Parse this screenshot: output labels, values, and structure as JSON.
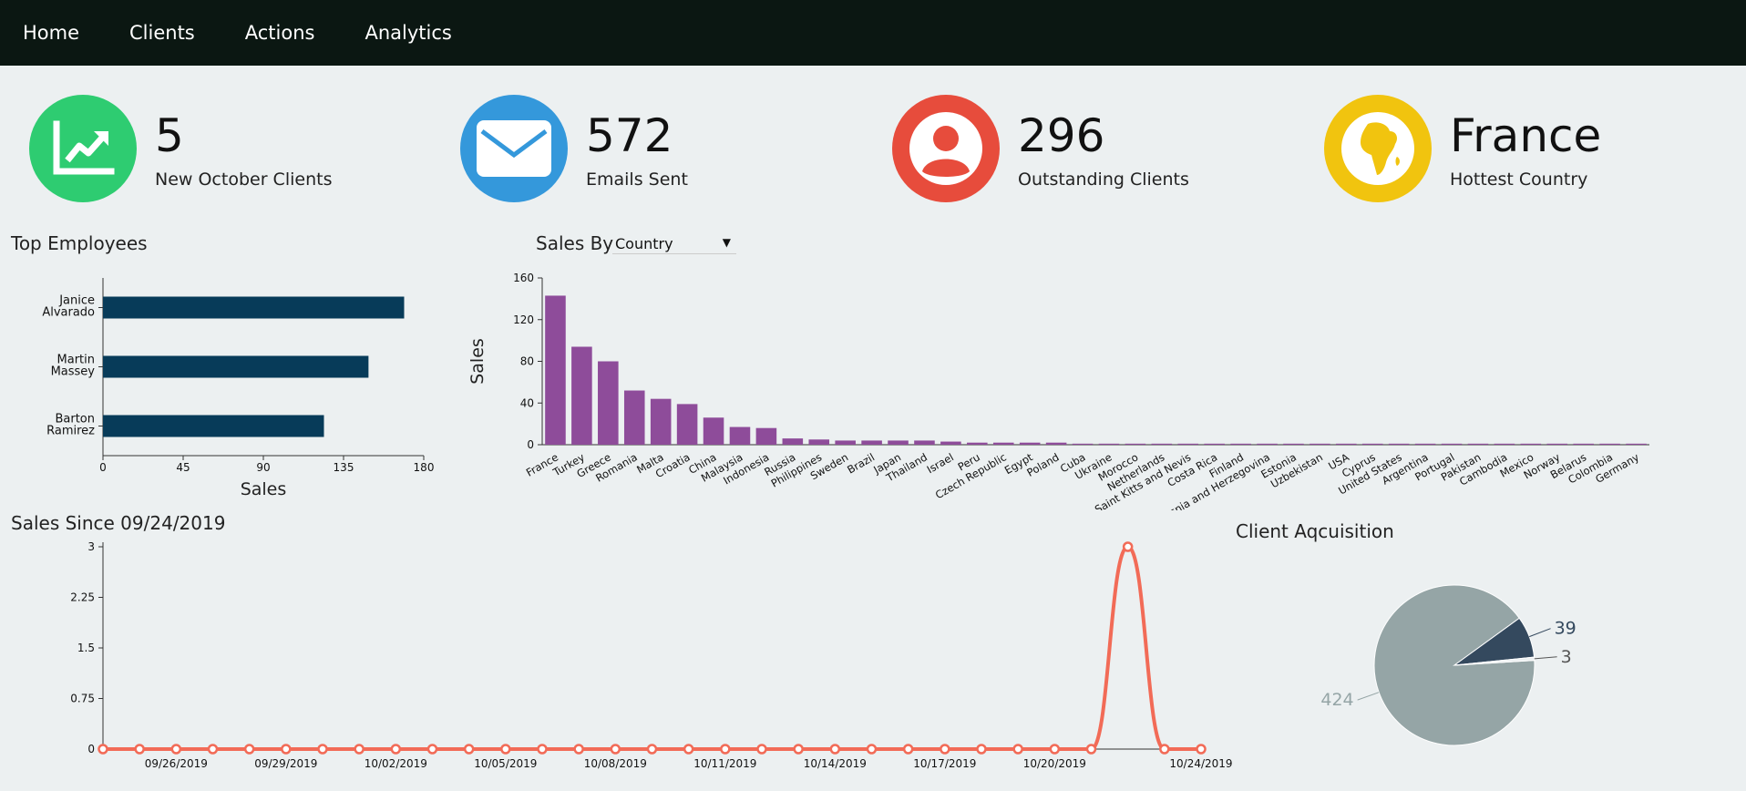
{
  "nav": {
    "items": [
      {
        "label": "Home"
      },
      {
        "label": "Clients"
      },
      {
        "label": "Actions"
      },
      {
        "label": "Analytics"
      }
    ]
  },
  "kpis": [
    {
      "value": "5",
      "label": "New October Clients",
      "color": "#2ecc71",
      "icon": "chart-trend-icon"
    },
    {
      "value": "572",
      "label": "Emails Sent",
      "color": "#3498db",
      "icon": "envelope-icon"
    },
    {
      "value": "296",
      "label": "Outstanding Clients",
      "color": "#e74c3c",
      "icon": "user-icon"
    },
    {
      "value": "France",
      "label": "Hottest Country",
      "color": "#f1c40f",
      "icon": "globe-africa-icon"
    }
  ],
  "top_employees": {
    "title": "Top Employees",
    "chart_data": {
      "type": "bar",
      "orientation": "horizontal",
      "categories": [
        "Janice Alvarado",
        "Martin Massey",
        "Barton Ramirez"
      ],
      "values": [
        169,
        149,
        124
      ],
      "xlabel": "Sales",
      "xlim": [
        0,
        180
      ],
      "xticks": [
        0,
        45,
        90,
        135,
        180
      ],
      "color": "#073b59"
    }
  },
  "sales_by": {
    "title": "Sales By",
    "select_value": "Country",
    "chart_data": {
      "type": "bar",
      "categories": [
        "France",
        "Turkey",
        "Greece",
        "Romania",
        "Malta",
        "Croatia",
        "China",
        "Malaysia",
        "Indonesia",
        "Russia",
        "Philippines",
        "Sweden",
        "Brazil",
        "Japan",
        "Thailand",
        "Israel",
        "Peru",
        "Czech Republic",
        "Egypt",
        "Poland",
        "Cuba",
        "Ukraine",
        "Morocco",
        "Netherlands",
        "Saint Kitts and Nevis",
        "Costa Rica",
        "Finland",
        "Bosnia and Herzegovina",
        "Estonia",
        "Uzbekistan",
        "USA",
        "Cyprus",
        "United States",
        "Argentina",
        "Portugal",
        "Pakistan",
        "Cambodia",
        "Mexico",
        "Norway",
        "Belarus",
        "Colombia",
        "Germany"
      ],
      "values": [
        143,
        94,
        80,
        52,
        44,
        39,
        26,
        17,
        16,
        6,
        5,
        4,
        4,
        4,
        4,
        3,
        2,
        2,
        2,
        2,
        1,
        1,
        1,
        1,
        1,
        1,
        1,
        1,
        1,
        1,
        1,
        1,
        1,
        1,
        1,
        1,
        1,
        1,
        1,
        1,
        1,
        1
      ],
      "ylabel": "Sales",
      "ylim": [
        0,
        160
      ],
      "yticks": [
        0,
        40,
        80,
        120,
        160
      ],
      "color": "#8e4c9a"
    }
  },
  "sales_since": {
    "title": "Sales Since 09/24/2019",
    "chart_data": {
      "type": "line",
      "x": [
        "09/24/2019",
        "09/25/2019",
        "09/26/2019",
        "09/27/2019",
        "09/28/2019",
        "09/29/2019",
        "09/30/2019",
        "10/01/2019",
        "10/02/2019",
        "10/03/2019",
        "10/04/2019",
        "10/05/2019",
        "10/06/2019",
        "10/07/2019",
        "10/08/2019",
        "10/09/2019",
        "10/10/2019",
        "10/11/2019",
        "10/12/2019",
        "10/13/2019",
        "10/14/2019",
        "10/15/2019",
        "10/16/2019",
        "10/17/2019",
        "10/18/2019",
        "10/19/2019",
        "10/20/2019",
        "10/21/2019",
        "10/22/2019",
        "10/23/2019",
        "10/24/2019"
      ],
      "values": [
        0,
        0,
        0,
        0,
        0,
        0,
        0,
        0,
        0,
        0,
        0,
        0,
        0,
        0,
        0,
        0,
        0,
        0,
        0,
        0,
        0,
        0,
        0,
        0,
        0,
        0,
        0,
        0,
        3,
        0,
        0
      ],
      "xticks": [
        "09/26/2019",
        "09/29/2019",
        "10/02/2019",
        "10/05/2019",
        "10/08/2019",
        "10/11/2019",
        "10/14/2019",
        "10/17/2019",
        "10/20/2019",
        "10/24/2019"
      ],
      "ylim": [
        0,
        3
      ],
      "yticks": [
        "0",
        "0.75",
        "1.5",
        "2.25",
        "3"
      ],
      "color": "#f26b57"
    }
  },
  "client_acquisition": {
    "title": "Client Aqcuisition",
    "chart_data": {
      "type": "pie",
      "values": [
        424,
        39,
        3
      ],
      "labels": [
        "424",
        "39",
        "3"
      ],
      "colors": [
        "#95a5a6",
        "#34495e",
        "#ecf0f1"
      ]
    }
  }
}
